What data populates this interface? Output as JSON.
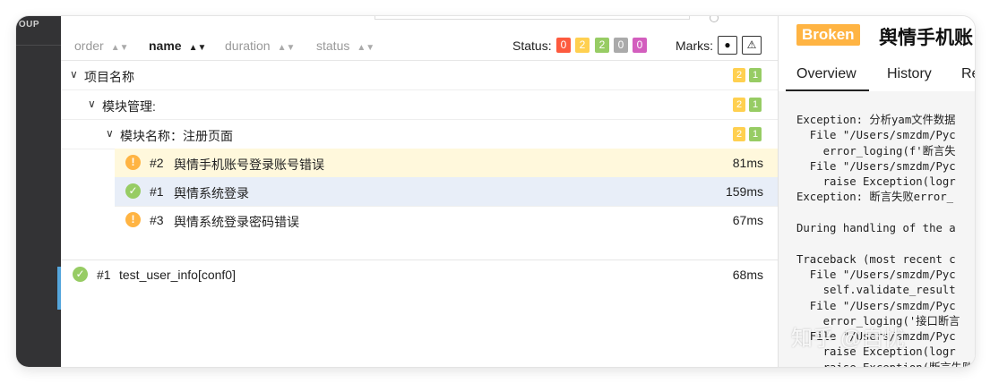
{
  "sidebar": {
    "logo_text": "OUP"
  },
  "toolbar": {
    "sort": [
      {
        "label": "order",
        "active": false
      },
      {
        "label": "name",
        "active": true
      },
      {
        "label": "duration",
        "active": false
      },
      {
        "label": "status",
        "active": false
      }
    ],
    "status_label": "Status:",
    "status_counts": [
      {
        "value": "0",
        "color": "#fd5a3e"
      },
      {
        "value": "2",
        "color": "#ffd050"
      },
      {
        "value": "2",
        "color": "#97cc64"
      },
      {
        "value": "0",
        "color": "#aaaaaa"
      },
      {
        "value": "0",
        "color": "#d35ebe"
      }
    ],
    "marks_label": "Marks:",
    "marks": [
      "bomb-icon",
      "warning-icon"
    ]
  },
  "tree": {
    "groups": [
      {
        "label": "项目名称",
        "counts": [
          "2",
          "1"
        ]
      },
      {
        "label": "模块管理:",
        "counts": [
          "2",
          "1"
        ]
      },
      {
        "label": "模块名称：注册页面",
        "counts": [
          "2",
          "1"
        ]
      }
    ],
    "cases": [
      {
        "num": "#2",
        "name": "舆情手机账号登录账号错误",
        "duration": "81ms",
        "status": "broken"
      },
      {
        "num": "#1",
        "name": "舆情系统登录",
        "duration": "159ms",
        "status": "passed"
      },
      {
        "num": "#3",
        "name": "舆情系统登录密码错误",
        "duration": "67ms",
        "status": "broken"
      }
    ],
    "root_case": {
      "num": "#1",
      "name": "test_user_info[conf0]",
      "duration": "68ms",
      "status": "passed"
    }
  },
  "colors": {
    "broken": "#ffb443",
    "passed": "#97cc64",
    "selected_broken_bg": "#fff8dc",
    "selected_bg": "#e8eef8"
  },
  "detail": {
    "badge": "Broken",
    "title": "舆情手机账",
    "tabs": [
      "Overview",
      "History",
      "Re"
    ],
    "trace": "Exception: 分析yam文件数据\n  File \"/Users/smzdm/Pyc\n    error_loging(f'断言失\n  File \"/Users/smzdm/Pyc\n    raise Exception(logr\nException: 断言失败error_\n\nDuring handling of the a\n\nTraceback (most recent c\n  File \"/Users/smzdm/Pyc\n    self.validate_result\n  File \"/Users/smzdm/Pyc\n    error_loging('接口断言\n  File \"/Users/smzdm/Pyc\n    raise Exception(logr\n    raise Exception(断言失败"
  },
  "watermark": "知乎 @自忧"
}
